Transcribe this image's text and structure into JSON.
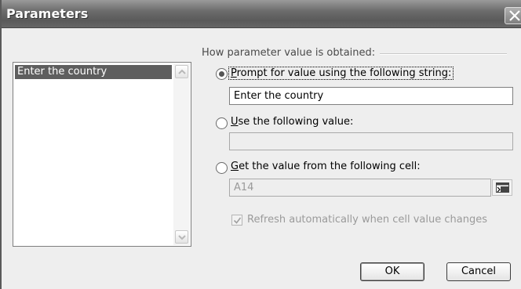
{
  "window": {
    "title": "Parameters"
  },
  "list": {
    "items": [
      "Enter the country"
    ]
  },
  "group": {
    "label": "How parameter value is obtained:"
  },
  "options": {
    "prompt": {
      "underline_char": "P",
      "label_rest": "rompt for value using the following string:",
      "selected": true,
      "value": "Enter the country"
    },
    "use_value": {
      "underline_char": "U",
      "label_rest": "se the following value:",
      "selected": false,
      "value": ""
    },
    "get_cell": {
      "underline_char": "G",
      "label_rest": "et the value from the following cell:",
      "selected": false,
      "value": "A14"
    }
  },
  "refresh": {
    "label": "Refresh automatically when cell value changes",
    "checked": true,
    "enabled": false
  },
  "buttons": {
    "ok": "OK",
    "cancel": "Cancel"
  },
  "icons": {
    "close": "close-icon",
    "scroll_up": "chevron-up-icon",
    "scroll_down": "chevron-down-icon",
    "cell_ref": "collapse-dialog-icon",
    "check": "checkmark-icon"
  },
  "colors": {
    "titlebar": "#6c6c6c",
    "selection": "#5e5e5e",
    "dialog_bg": "#eeeeee"
  }
}
